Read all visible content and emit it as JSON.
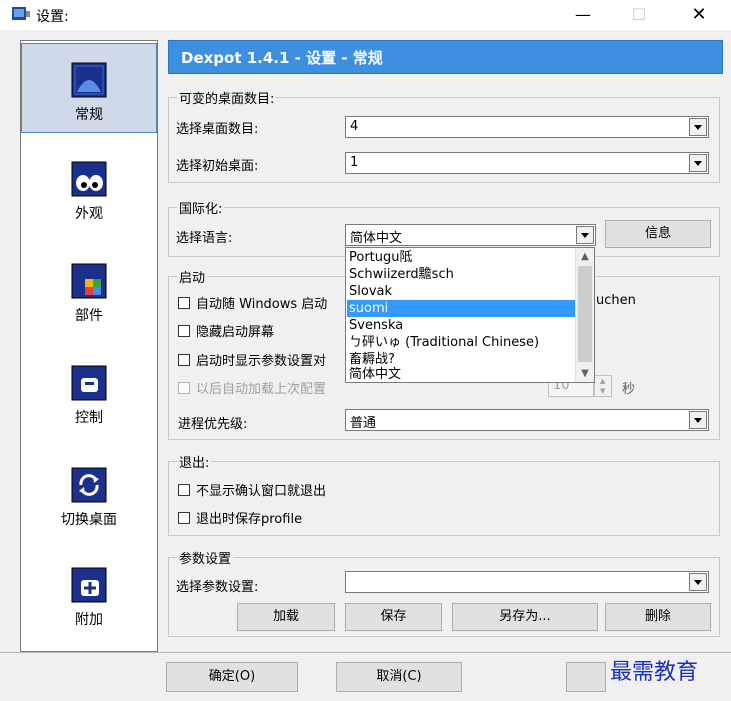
{
  "window": {
    "title": "设置:",
    "minimize": "—",
    "maximize": "☐",
    "close": "✕"
  },
  "sidebar": {
    "items": [
      {
        "label": "常规",
        "active": true,
        "icon": "window-icon"
      },
      {
        "label": "外观",
        "active": false,
        "icon": "eyes-icon"
      },
      {
        "label": "部件",
        "active": false,
        "icon": "widget-icon"
      },
      {
        "label": "控制",
        "active": false,
        "icon": "control-icon"
      },
      {
        "label": "切换桌面",
        "active": false,
        "icon": "switch-icon"
      },
      {
        "label": "附加",
        "active": false,
        "icon": "plus-icon"
      }
    ]
  },
  "header": {
    "title": "Dexpot 1.4.1 - 设置 - 常规"
  },
  "desktops": {
    "group_title": "可变的桌面数目:",
    "count_label": "选择桌面数目:",
    "count_value": "4",
    "initial_label": "选择初始桌面:",
    "initial_value": "1"
  },
  "i18n": {
    "group_title": "国际化:",
    "language_label": "选择语言:",
    "language_value": "简体中文",
    "info_button": "信息",
    "options": [
      "Portugu阺",
      "Schwiizerd黵sch",
      "Slovak",
      "suomi",
      "Svenska",
      "ㄅ砰いゅ (Traditional Chinese)",
      "畜耨战?",
      "简体中文"
    ],
    "selected_option": "suomi"
  },
  "startup": {
    "group_title": "启动",
    "autostart_label": "自动随 Windows 启动",
    "autostart_tail": "uchen",
    "hide_splash_label": "隐藏启动屏幕",
    "show_config_label": "启动时显示参数设置对",
    "autoload_label": "以后自动加载上次配置",
    "delay_value": "10",
    "seconds_label": "秒",
    "priority_label": "进程优先级:",
    "priority_value": "普通"
  },
  "exit": {
    "group_title": "退出:",
    "no_confirm_label": "不显示确认窗口就退出",
    "save_profile_label": "退出时保存profile"
  },
  "profile": {
    "group_title": "参数设置",
    "select_label": "选择参数设置:",
    "select_value": "",
    "load_button": "加载",
    "save_button": "保存",
    "save_as_button": "另存为...",
    "delete_button": "删除"
  },
  "footer": {
    "ok_button": "确定(O)",
    "cancel_button": "取消(C)"
  },
  "watermark": {
    "text": "最需教育"
  },
  "colors": {
    "accent": "#3d8fe0",
    "selection": "#3399ff",
    "watermark": "#1d2fbf"
  }
}
